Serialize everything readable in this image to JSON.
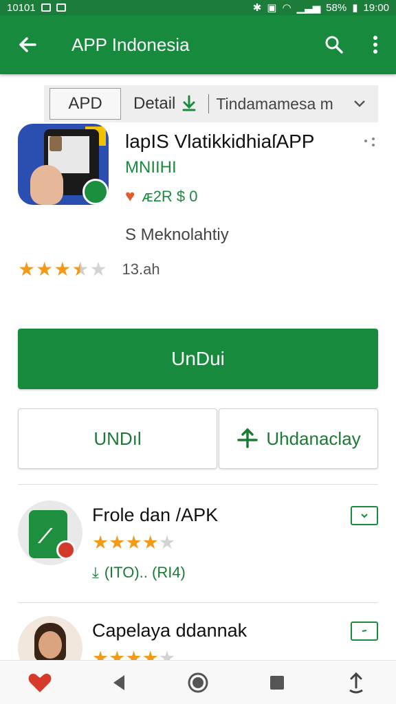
{
  "status_bar": {
    "left_text": "10101",
    "battery": "58%",
    "time": "19:00"
  },
  "app_bar": {
    "title": "APP Indonesia",
    "back_icon": "arrow-left-icon",
    "search_icon": "search-icon",
    "more_icon": "more-vert-icon"
  },
  "filter_bar": {
    "tab_app": "APD",
    "tab_detail": "Detail",
    "dropdown_value": "Tindamamesa m"
  },
  "app": {
    "name": "lapIS VlatikkidhiaſAPP",
    "subtitle": "MNIIHI",
    "price_text": "ᴁ2R $ 0",
    "developer": "S Meknolahtiy",
    "rating": 3.5,
    "rating_count": "13.ah"
  },
  "primary_button": {
    "label": "UnDui"
  },
  "secondary_buttons": {
    "left_label": "UNDıl",
    "right_label": "Uhdanaclay"
  },
  "list": [
    {
      "title": "Frole dan /APK",
      "stars": 4,
      "meta": "(ITO).. (RI4)"
    },
    {
      "title": "Capelaya ddannak",
      "stars": 4,
      "meta": ""
    }
  ],
  "colors": {
    "primary": "#188a3e",
    "accent_star": "#f29b1b"
  }
}
